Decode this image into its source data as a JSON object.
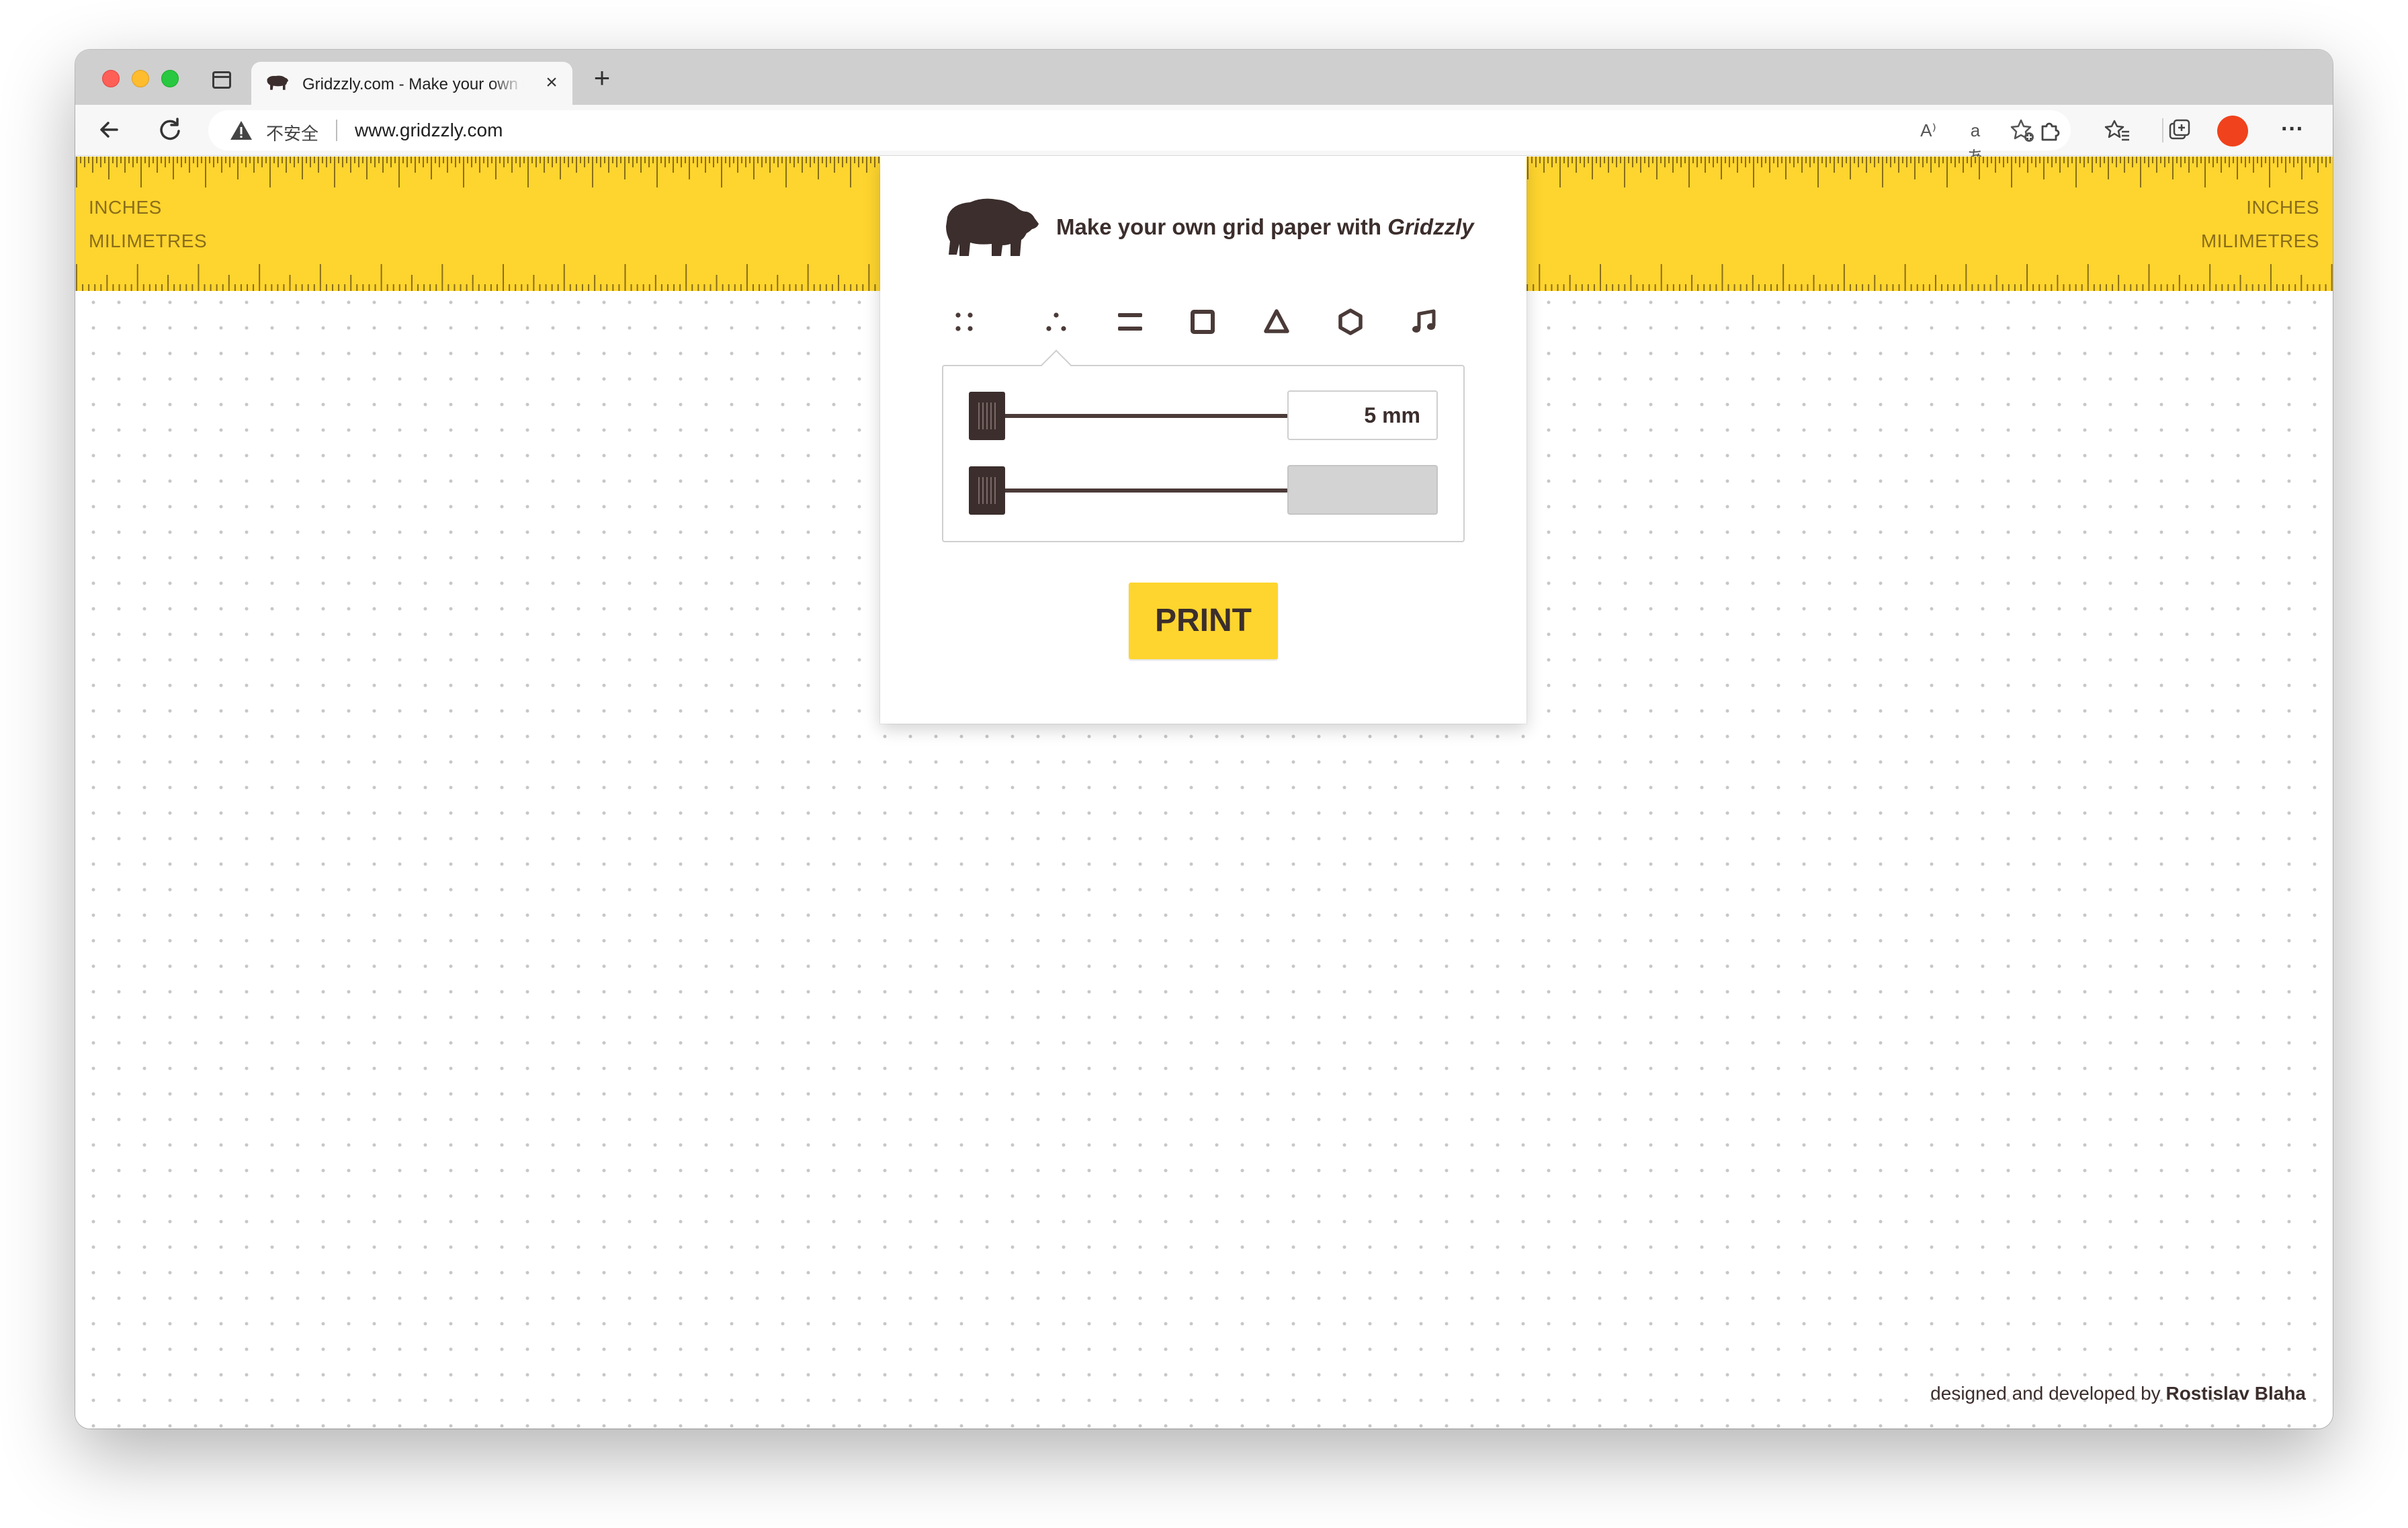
{
  "browser": {
    "tab_title": "Gridzzly.com - Make your own grid paper",
    "tab_close": "×",
    "new_tab": "+",
    "insecure_label": "不安全",
    "url": "www.gridzzly.com",
    "read_aloud_glyph": "A⁾",
    "translate_glyph": "aあ",
    "more_glyph": "···",
    "profile_color": "#f0421c"
  },
  "ruler": {
    "left_top_label": "INCHES",
    "left_bottom_label": "MILIMETRES",
    "right_top_label": "INCHES",
    "right_bottom_label": "MILIMETRES",
    "color": "#fed52e"
  },
  "panel": {
    "headline_prefix": "Make your own grid paper with ",
    "headline_brand": "Gridzzly",
    "patterns": [
      "dot-grid",
      "triangular-dots",
      "lines",
      "square-grid",
      "triangle-grid",
      "hexagon-grid",
      "music-staff"
    ],
    "selected_pattern": "triangular-dots",
    "size_value": "5",
    "size_unit": "mm",
    "second_value": "",
    "print_label": "PRINT",
    "accent_color": "#fed52e",
    "text_color": "#3b2e2c"
  },
  "footer": {
    "credit_prefix": "designed and developed by ",
    "credit_author": "Rostislav Blaha"
  }
}
